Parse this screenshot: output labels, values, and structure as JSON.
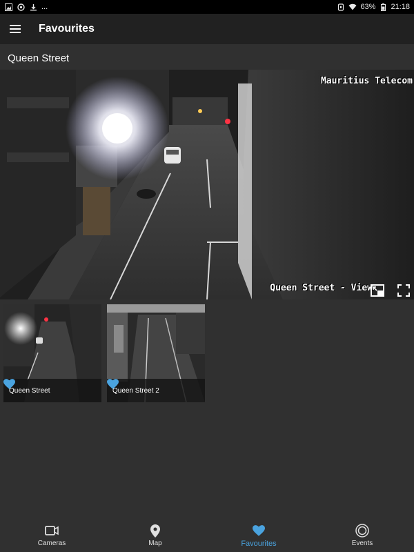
{
  "status_bar": {
    "dots": "...",
    "battery": "63%",
    "time": "21:18"
  },
  "app_bar": {
    "title": "Favourites",
    "menu_icon": "hamburger-menu-icon"
  },
  "section": {
    "title": "Queen Street"
  },
  "main_feed": {
    "overlay_top": "Mauritius Telecom",
    "overlay_bottom": "Queen Street - View",
    "buttons": [
      "picture-in-picture-icon",
      "fullscreen-icon"
    ]
  },
  "favourites": [
    {
      "label": "Queen Street",
      "favourited": true
    },
    {
      "label": "Queen Street 2",
      "favourited": true
    }
  ],
  "bottom_nav": {
    "items": [
      {
        "label": "Cameras",
        "icon": "video-camera-icon",
        "active": false
      },
      {
        "label": "Map",
        "icon": "map-pin-icon",
        "active": false
      },
      {
        "label": "Favourites",
        "icon": "heart-icon",
        "active": true
      },
      {
        "label": "Events",
        "icon": "events-circle-icon",
        "active": false
      }
    ]
  },
  "colors": {
    "background": "#303030",
    "app_bar": "#212121",
    "accent": "#4aa3df"
  }
}
